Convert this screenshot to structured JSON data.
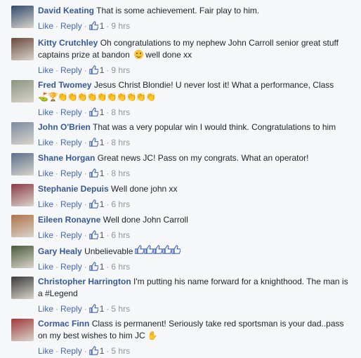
{
  "actions": {
    "like_label": "Like",
    "reply_label": "Reply"
  },
  "comments": [
    {
      "author": "David Keating",
      "text": "That is some achievement. Fair play to him.",
      "emoji": "",
      "likes": "1",
      "time": "9 hrs",
      "avatar_color": "#2f4a6e"
    },
    {
      "author": "Kitty Crutchley",
      "text": "Oh congratulations to my nephew John Carroll senior great stuff captains prize at bandon",
      "emoji": "well done xx",
      "likes": "1",
      "time": "9 hrs",
      "avatar_color": "#6b4a3a"
    },
    {
      "author": "Fred Twomey",
      "text": "Jesus Christ Blondie! U never lost it! What a performance, Class",
      "emoji": "",
      "likes": "1",
      "time": "8 hrs",
      "avatar_color": "#8a9480"
    },
    {
      "author": "John O'Brien",
      "text": "That was a very popular win I would think. Congratulations to him",
      "emoji": "",
      "likes": "1",
      "time": "8 hrs",
      "avatar_color": "#7a8aa0"
    },
    {
      "author": "Shane Horgan",
      "text": "Great news JC! Pass on my congrats. What an operator!",
      "emoji": "",
      "likes": "1",
      "time": "8 hrs",
      "avatar_color": "#5a6f8c"
    },
    {
      "author": "Stephanie Depuis",
      "text": "Well done john xx",
      "emoji": "",
      "likes": "1",
      "time": "6 hrs",
      "avatar_color": "#8c3a4a"
    },
    {
      "author": "Eileen Ronayne",
      "text": "Well done John Carroll",
      "emoji": "",
      "likes": "1",
      "time": "6 hrs",
      "avatar_color": "#b0734a"
    },
    {
      "author": "Gary Healy",
      "text": "Unbelievable",
      "emoji": "",
      "likes": "1",
      "time": "6 hrs",
      "avatar_color": "#4a5a3a"
    },
    {
      "author": "Christopher Harrington",
      "text": "I'm putting his name forward for a knighthood. The man is a #Legend",
      "emoji": "",
      "likes": "1",
      "time": "5 hrs",
      "avatar_color": "#3a3a3a"
    },
    {
      "author": "Cormac Finn",
      "text": "Class is permanent! Seriously take red sportsman is your dad..pass on my best wishes to him JC",
      "emoji": "",
      "likes": "1",
      "time": "5 hrs",
      "avatar_color": "#a03a3a"
    }
  ]
}
